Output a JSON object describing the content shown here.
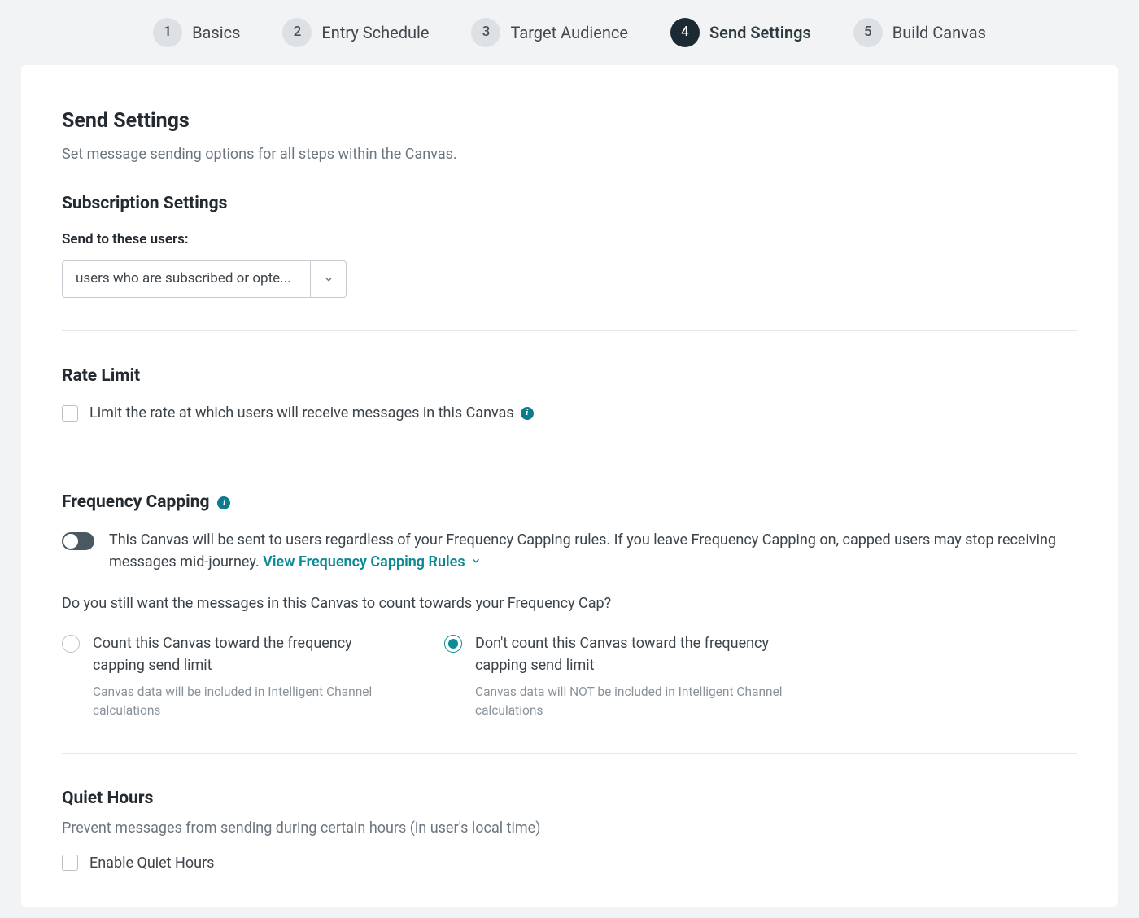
{
  "stepper": {
    "items": [
      {
        "num": "1",
        "label": "Basics",
        "active": false
      },
      {
        "num": "2",
        "label": "Entry Schedule",
        "active": false
      },
      {
        "num": "3",
        "label": "Target Audience",
        "active": false
      },
      {
        "num": "4",
        "label": "Send Settings",
        "active": true
      },
      {
        "num": "5",
        "label": "Build Canvas",
        "active": false
      }
    ]
  },
  "header": {
    "title": "Send Settings",
    "description": "Set message sending options for all steps within the Canvas."
  },
  "subscription": {
    "title": "Subscription Settings",
    "field_label": "Send to these users:",
    "selected": "users who are subscribed or opte..."
  },
  "rate_limit": {
    "title": "Rate Limit",
    "checkbox_label": "Limit the rate at which users will receive messages in this Canvas"
  },
  "frequency": {
    "title": "Frequency Capping",
    "toggle_desc": "This Canvas will be sent to users regardless of your Frequency Capping rules. If you leave Frequency Capping on, capped users may stop receiving messages mid-journey.  ",
    "link": "View Frequency Capping Rules",
    "question": "Do you still want the messages in this Canvas to count towards your Frequency Cap?",
    "options": [
      {
        "label": "Count this Canvas toward the frequency capping send limit",
        "hint": "Canvas data will be included in Intelligent Channel calculations",
        "selected": false
      },
      {
        "label": "Don't count this Canvas toward the frequency capping send limit",
        "hint": "Canvas data will NOT be included in Intelligent Channel calculations",
        "selected": true
      }
    ]
  },
  "quiet_hours": {
    "title": "Quiet Hours",
    "description": "Prevent messages from sending during certain hours (in user's local time)",
    "checkbox_label": "Enable Quiet Hours"
  },
  "colors": {
    "accent": "#0e8a94",
    "step_active_bg": "#1b2a33"
  }
}
